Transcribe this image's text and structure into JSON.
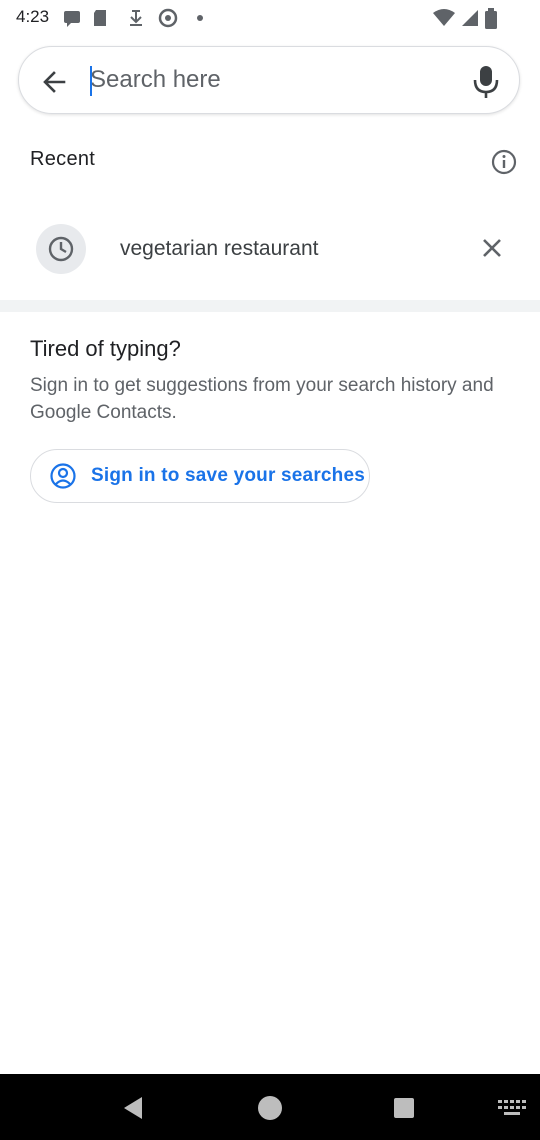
{
  "status_bar": {
    "time": "4:23",
    "icons": [
      "sms-icon",
      "sd-card-icon",
      "download-icon",
      "chrome-icon",
      "dot-icon",
      "wifi-icon",
      "signal-icon",
      "battery-icon"
    ]
  },
  "search": {
    "placeholder": "Search here",
    "value": ""
  },
  "recent": {
    "heading": "Recent",
    "items": [
      {
        "label": "vegetarian restaurant",
        "icon": "clock-icon"
      }
    ]
  },
  "signin_card": {
    "title": "Tired of typing?",
    "body": "Sign in to get suggestions from your search history and Google Contacts.",
    "button_label": "Sign in to save your searches"
  },
  "colors": {
    "accent": "#1a73e8",
    "text_primary": "#202124",
    "text_secondary": "#5f6368",
    "divider": "#f1f3f4",
    "nav_bar": "#000000"
  }
}
